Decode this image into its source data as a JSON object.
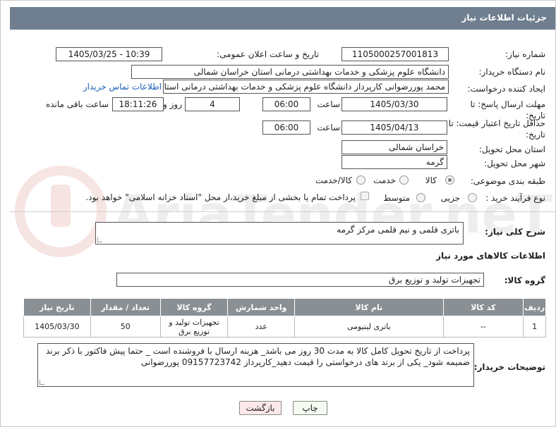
{
  "header": {
    "title": "جزئیات اطلاعات نیاز"
  },
  "watermark_text": "AriaTender.neT",
  "fields": {
    "need_number": {
      "label": "شماره نیاز:",
      "value": "1105000257001813"
    },
    "announce_datetime": {
      "label": "تاریخ و ساعت اعلان عمومی:",
      "value": "1405/03/25 - 10:39"
    },
    "buyer_org": {
      "label": "نام دستگاه خریدار:",
      "value": "دانشگاه علوم پزشکی و خدمات بهداشتی درمانی استان خراسان شمالی"
    },
    "requester": {
      "label": "ایجاد کننده درخواست:",
      "value": "محمد پوررضوانی کارپرداز دانشگاه علوم پزشکی و خدمات بهداشتی درمانی استان",
      "contact_link": "اطلاعات تماس خریدار"
    },
    "reply_deadline": {
      "label": "مهلت ارسال پاسخ: تا تاریخ:",
      "date": "1405/03/30",
      "time_label": "ساعت",
      "time": "06:00",
      "days": "4",
      "days_label": "روز و",
      "remaining": "18:11:26",
      "remaining_label": "ساعت باقی مانده"
    },
    "price_validity": {
      "label": "حداقل تاریخ اعتبار قیمت: تا تاریخ:",
      "date": "1405/04/13",
      "time_label": "ساعت",
      "time": "06:00"
    },
    "delivery_province": {
      "label": "استان محل تحویل:",
      "value": "خراسان شمالی"
    },
    "delivery_city": {
      "label": "شهر محل تحویل:",
      "value": "گرمه"
    },
    "category": {
      "label": "طبقه بندی موضوعی:",
      "options": [
        "کالا",
        "خدمت",
        "کالا/خدمت"
      ],
      "selected": "کالا"
    },
    "purchase_process": {
      "label": "نوع فرآیند خرید :",
      "options": [
        "جزیی",
        "متوسط"
      ],
      "selected": "",
      "payment_note": "پرداخت تمام یا بخشی از مبلغ خرید،از محل \"اسناد خزانه اسلامی\" خواهد بود."
    }
  },
  "need_description": {
    "label": "شرح کلی نیاز:",
    "value": "باتری قلمی و نیم قلمی مرکز گرمه"
  },
  "goods_info": {
    "heading": "اطلاعات کالاهای مورد نیاز"
  },
  "goods_group": {
    "label": "گروه کالا:",
    "value": "تجهیزات تولید و توزیع برق"
  },
  "items_table": {
    "headers": [
      "ردیف",
      "کد کالا",
      "نام کالا",
      "واحد شمارش",
      "گروه کالا",
      "تعداد / مقدار",
      "تاریخ نیاز"
    ],
    "rows": [
      {
        "row": "1",
        "code": "--",
        "name": "باتری لیتیومی",
        "unit": "عدد",
        "group": "تجهیزات تولید و توزیع برق",
        "qty": "50",
        "date": "1405/03/30"
      }
    ]
  },
  "buyer_notes": {
    "label": "توضیحات خریدار:",
    "value": "پرداخت از تاریخ تحویل کامل کالا به مدت 30 روز می باشد_ هزینه ارسال با فروشنده است _ حتما پیش فاکتور با ذکر برند ضمیمه شود_ یکی از برند های درخواستی را قیمت دهید_کارپرداز 09157723742 پوررضوانی"
  },
  "buttons": {
    "print": "چاپ",
    "back": "بازگشت"
  },
  "colors": {
    "titlebar": "#6f7f8f",
    "table_header": "#8a8f94",
    "print_button": "#f4faf0",
    "back_button": "#fde9ea",
    "link": "#1a5fb4"
  }
}
